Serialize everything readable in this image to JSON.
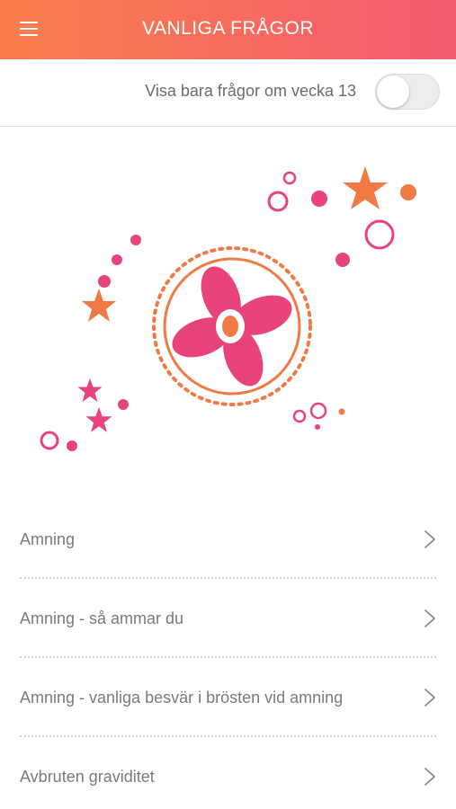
{
  "header": {
    "title": "VANLIGA FRÅGOR",
    "menu_icon": "hamburger-menu-icon"
  },
  "filter": {
    "label": "Visa bara frågor om vecka 13",
    "toggle_on": false
  },
  "colors": {
    "header_start": "#f9804c",
    "header_end": "#f55a73",
    "pink": "#e8437a",
    "orange": "#f07a45",
    "text_gray": "#7a7a7a"
  },
  "faq": {
    "items": [
      {
        "label": "Amning"
      },
      {
        "label": "Amning - så ammar du"
      },
      {
        "label": "Amning - vanliga besvär i brösten vid amning"
      },
      {
        "label": "Avbruten graviditet"
      }
    ]
  }
}
